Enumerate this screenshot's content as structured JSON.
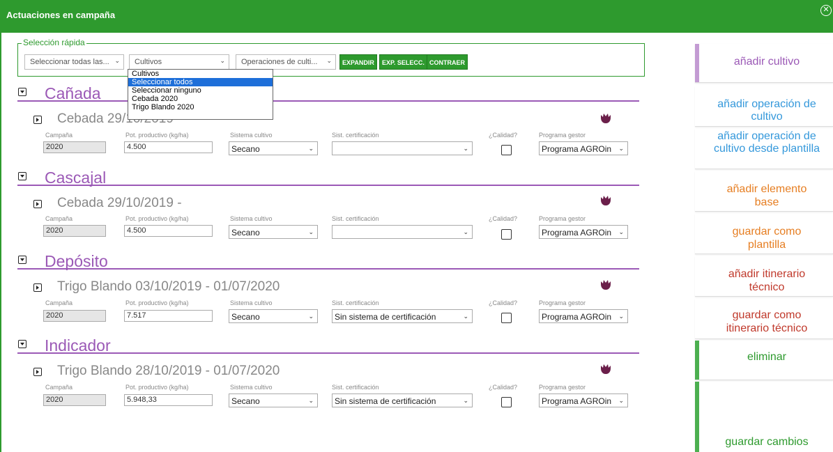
{
  "window": {
    "title": "Actuaciones en campaña",
    "close_icon": "close-circle-icon"
  },
  "quick_select": {
    "legend": "Selección rápida",
    "select_all_of": "Seleccionar todas las...",
    "crops": "Cultivos",
    "operations": "Operaciones de culti...",
    "expand": "EXPANDIR",
    "expand_selected": "EXP. SELECC.",
    "collapse": "CONTRAER",
    "dropdown_options": [
      "Cultivos",
      "Seleccionar todos",
      "Seleccionar ninguno",
      "Cebada 2020",
      "Trigo Blando 2020"
    ],
    "dropdown_selected": "Seleccionar todos"
  },
  "labels": {
    "campaign": "Campaña",
    "potential": "Pot. productivo (kg/ha)",
    "system": "Sistema cultivo",
    "certification": "Sist. certificación",
    "quality": "¿Calidad?",
    "manager": "Programa gestor"
  },
  "sections": [
    {
      "name": "Cañada",
      "crop": "Cebada 29/10/2019",
      "campaign": "2020",
      "potential": "4.500",
      "system": "Secano",
      "certification": "",
      "manager": "Programa AGROin"
    },
    {
      "name": "Cascajal",
      "crop": "Cebada 29/10/2019 -",
      "campaign": "2020",
      "potential": "4.500",
      "system": "Secano",
      "certification": "",
      "manager": "Programa AGROin"
    },
    {
      "name": "Depósito",
      "crop": "Trigo Blando 03/10/2019 - 01/07/2020",
      "campaign": "2020",
      "potential": "7.517",
      "system": "Secano",
      "certification": "Sin sistema de certificación",
      "manager": "Programa AGROin"
    },
    {
      "name": "Indicador",
      "crop": "Trigo Blando 28/10/2019 - 01/07/2020",
      "campaign": "2020",
      "potential": "5.948,33",
      "system": "Secano",
      "certification": "Sin sistema de certificación",
      "manager": "Programa AGROin"
    }
  ],
  "side_buttons": [
    {
      "label": "añadir cultivo",
      "color": "#9b59b6"
    },
    {
      "label": "añadir operación de cultivo",
      "color": "#3498db"
    },
    {
      "label": "añadir operación de cultivo desde plantilla",
      "color": "#3498db"
    },
    {
      "label": "añadir elemento base",
      "color": "#e67e22"
    },
    {
      "label": "guardar como plantilla",
      "color": "#e67e22"
    },
    {
      "label": "añadir itinerario técnico",
      "color": "#c0392b"
    },
    {
      "label": "guardar como itinerario técnico",
      "color": "#c0392b"
    },
    {
      "label": "eliminar",
      "color": "#2e9a2e"
    },
    {
      "label": "guardar cambios",
      "color": "#2e9a2e"
    }
  ],
  "colors": {
    "header_green": "#2e9a2e",
    "section_purple": "#9b59b6",
    "flower_icon": "#6b1f4a"
  }
}
